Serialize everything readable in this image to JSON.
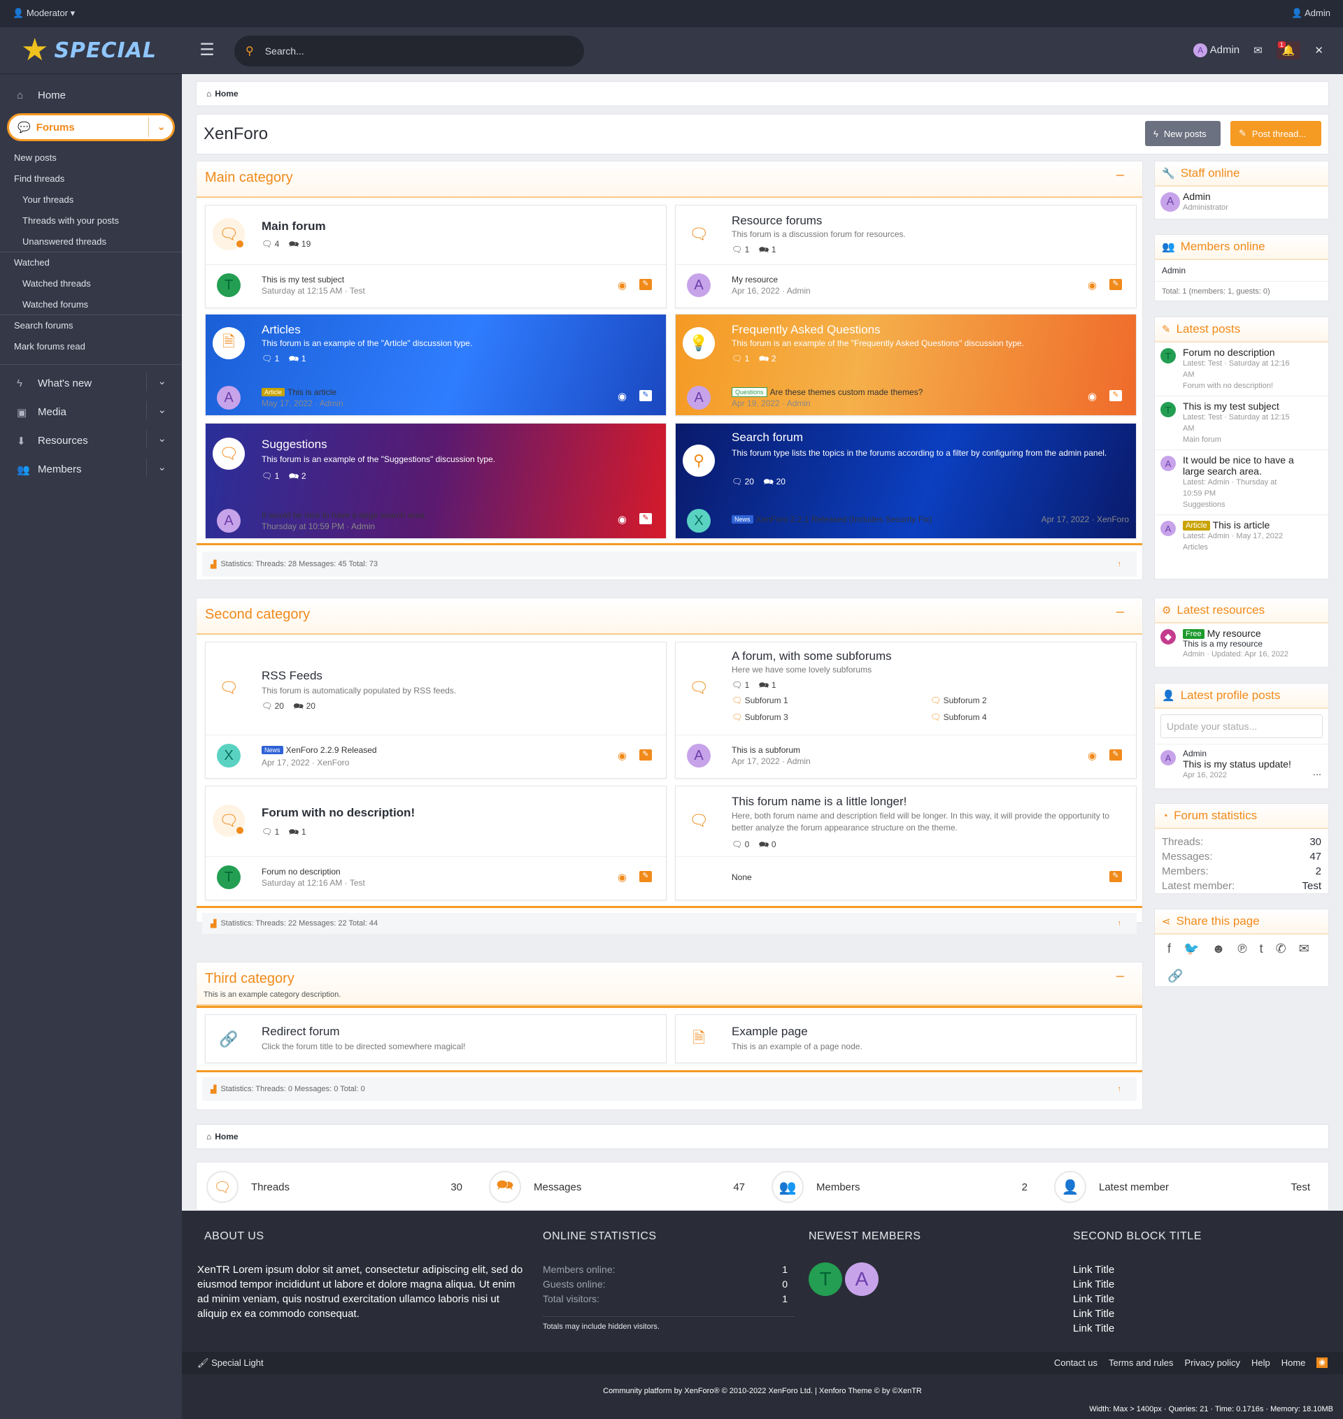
{
  "topbar": {
    "left": "Moderator",
    "right": "Admin"
  },
  "brand": {
    "name": "SPECIAL"
  },
  "sidebar": {
    "home": "Home",
    "forums": "Forums",
    "forum_links": [
      "New posts",
      "Find threads",
      "Your threads",
      "Threads with your posts",
      "Unanswered threads",
      "Watched",
      "Watched threads",
      "Watched forums",
      "Search forums",
      "Mark forums read"
    ],
    "sections": [
      "What's new",
      "Media",
      "Resources",
      "Members"
    ]
  },
  "header": {
    "search_placeholder": "Search...",
    "user": "Admin",
    "alert_count": "1"
  },
  "breadcrumb": {
    "home": "Home"
  },
  "page": {
    "title": "XenForo",
    "new_posts": "New posts",
    "post_thread": "Post thread..."
  },
  "categories": [
    {
      "title": "Main category",
      "stats": "Statistics: Threads: 28 Messages: 45 Total: 73"
    },
    {
      "title": "Second category",
      "stats": "Statistics: Threads: 22 Messages: 22 Total: 44"
    },
    {
      "title": "Third category",
      "desc": "This is an example category description.",
      "stats": "Statistics: Threads: 0 Messages: 0 Total: 0"
    }
  ],
  "forums": {
    "main": {
      "title": "Main forum",
      "threads": "4",
      "messages": "19",
      "latest": "This is my test subject",
      "latest_meta": "Saturday at 12:15 AM · Test",
      "avatar": "T"
    },
    "resource": {
      "title": "Resource forums",
      "desc": "This forum is a discussion forum for resources.",
      "threads": "1",
      "messages": "1",
      "latest": "My resource",
      "latest_meta": "Apr 16, 2022 · Admin",
      "avatar": "A"
    },
    "articles": {
      "title": "Articles",
      "desc": "This forum is an example of the \"Article\" discussion type.",
      "threads": "1",
      "messages": "1",
      "badge": "Article",
      "latest": "This is article",
      "latest_meta": "May 17, 2022 · Admin",
      "avatar": "A"
    },
    "faq": {
      "title": "Frequently Asked Questions",
      "desc": "This forum is an example of the \"Frequently Asked Questions\" discussion type.",
      "threads": "1",
      "messages": "2",
      "badge": "Questions",
      "latest": "Are these themes custom made themes?",
      "latest_meta": "Apr 19, 2022 · Admin",
      "avatar": "A"
    },
    "suggestions": {
      "title": "Suggestions",
      "desc": "This forum is an example of the \"Suggestions\" discussion type.",
      "threads": "1",
      "messages": "2",
      "latest": "It would be nice to have a large search area.",
      "latest_meta": "Thursday at 10:59 PM · Admin",
      "avatar": "A"
    },
    "search": {
      "title": "Search forum",
      "desc": "This forum type lists the topics in the forums according to a filter by configuring from the admin panel.",
      "threads": "20",
      "messages": "20",
      "badge": "News",
      "latest": "XenForo 2.2.1 Released (Includes Security Fix)",
      "latest_meta": "Apr 17, 2022 · XenForo",
      "avatar": "X"
    },
    "rss": {
      "title": "RSS Feeds",
      "desc": "This forum is automatically populated by RSS feeds.",
      "threads": "20",
      "messages": "20",
      "badge": "News",
      "latest": "XenForo 2.2.9 Released",
      "latest_meta": "Apr 17, 2022 · XenForo",
      "avatar": "X"
    },
    "subforums": {
      "title": "A forum, with some subforums",
      "desc": "Here we have some lovely subforums",
      "threads": "1",
      "messages": "1",
      "subs": [
        "Subforum 1",
        "Subforum 2",
        "Subforum 3",
        "Subforum 4"
      ],
      "latest": "This is a subforum",
      "latest_meta": "Apr 17, 2022 · Admin",
      "avatar": "A"
    },
    "nodesc": {
      "title": "Forum with no description!",
      "threads": "1",
      "messages": "1",
      "latest": "Forum no description",
      "latest_meta": "Saturday at 12:16 AM · Test",
      "avatar": "T"
    },
    "longer": {
      "title": "This forum name is a little longer!",
      "desc": "Here, both forum name and description field will be longer. In this way, it will provide the opportunity to better analyze the forum appearance structure on the theme.",
      "threads": "0",
      "messages": "0",
      "latest": "None"
    },
    "redirect": {
      "title": "Redirect forum",
      "desc": "Click the forum title to be directed somewhere magical!"
    },
    "example": {
      "title": "Example page",
      "desc": "This is an example of a page node."
    }
  },
  "widgets": {
    "staff": {
      "title": "Staff online",
      "name": "Admin",
      "role": "Administrator"
    },
    "members": {
      "title": "Members online",
      "name": "Admin",
      "total": "Total: 1 (members: 1, guests: 0)"
    },
    "latest_posts": {
      "title": "Latest posts",
      "items": [
        {
          "t": "Forum no description",
          "s1": "Latest: Test · Saturday at 12:16",
          "s2": "AM",
          "s3": "Forum with no description!",
          "av": "T"
        },
        {
          "t": "This is my test subject",
          "s1": "Latest: Test · Saturday at 12:15",
          "s2": "AM",
          "s3": "Main forum",
          "av": "T"
        },
        {
          "t": "It would be nice to have a",
          "t2": "large search area.",
          "s1": "Latest: Admin · Thursday at",
          "s2": "10:59 PM",
          "s3": "Suggestions",
          "av": "A"
        },
        {
          "badge": "Article",
          "t": "This is article",
          "s1": "Latest: Admin · May 17, 2022",
          "s3": "Articles",
          "av": "A"
        }
      ]
    },
    "resources": {
      "title": "Latest resources",
      "badge": "Free",
      "name": "My resource",
      "desc": "This is a my resource",
      "meta": "Admin · Updated: Apr 16, 2022"
    },
    "profile": {
      "title": "Latest profile posts",
      "placeholder": "Update your status...",
      "user": "Admin",
      "text": "This is my status update!",
      "date": "Apr 16, 2022"
    },
    "stats": {
      "title": "Forum statistics",
      "rows": [
        [
          "Threads:",
          "30"
        ],
        [
          "Messages:",
          "47"
        ],
        [
          "Members:",
          "2"
        ],
        [
          "Latest member:",
          "Test"
        ]
      ]
    },
    "share": {
      "title": "Share this page"
    }
  },
  "stats_bar": [
    [
      "Threads",
      "30"
    ],
    [
      "Messages",
      "47"
    ],
    [
      "Members",
      "2"
    ],
    [
      "Latest member",
      "Test"
    ]
  ],
  "footer": {
    "about_title": "ABOUT US",
    "about": "XenTR Lorem ipsum dolor sit amet, consectetur adipiscing elit, sed do eiusmod tempor incididunt ut labore et dolore magna aliqua. Ut enim ad minim veniam, quis nostrud exercitation ullamco laboris nisi ut aliquip ex ea commodo consequat.",
    "online_title": "ONLINE STATISTICS",
    "online": [
      [
        "Members online:",
        "1"
      ],
      [
        "Guests online:",
        "0"
      ],
      [
        "Total visitors:",
        "1"
      ]
    ],
    "online_note": "Totals may include hidden visitors.",
    "newest_title": "NEWEST MEMBERS",
    "newest": [
      "T",
      "A"
    ],
    "second_title": "SECOND BLOCK TITLE",
    "links": [
      "Link Title",
      "Link Title",
      "Link Title",
      "Link Title",
      "Link Title"
    ],
    "style": "Special Light",
    "bar_links": [
      "Contact us",
      "Terms and rules",
      "Privacy policy",
      "Help",
      "Home"
    ],
    "copyright": "Community platform by XenForo® © 2010-2022 XenForo Ltd. | Xenforo Theme © by ©XenTR",
    "perf": "Width: Max > 1400px · Queries: 21 · Time: 0.1716s · Memory: 18.10MB"
  }
}
